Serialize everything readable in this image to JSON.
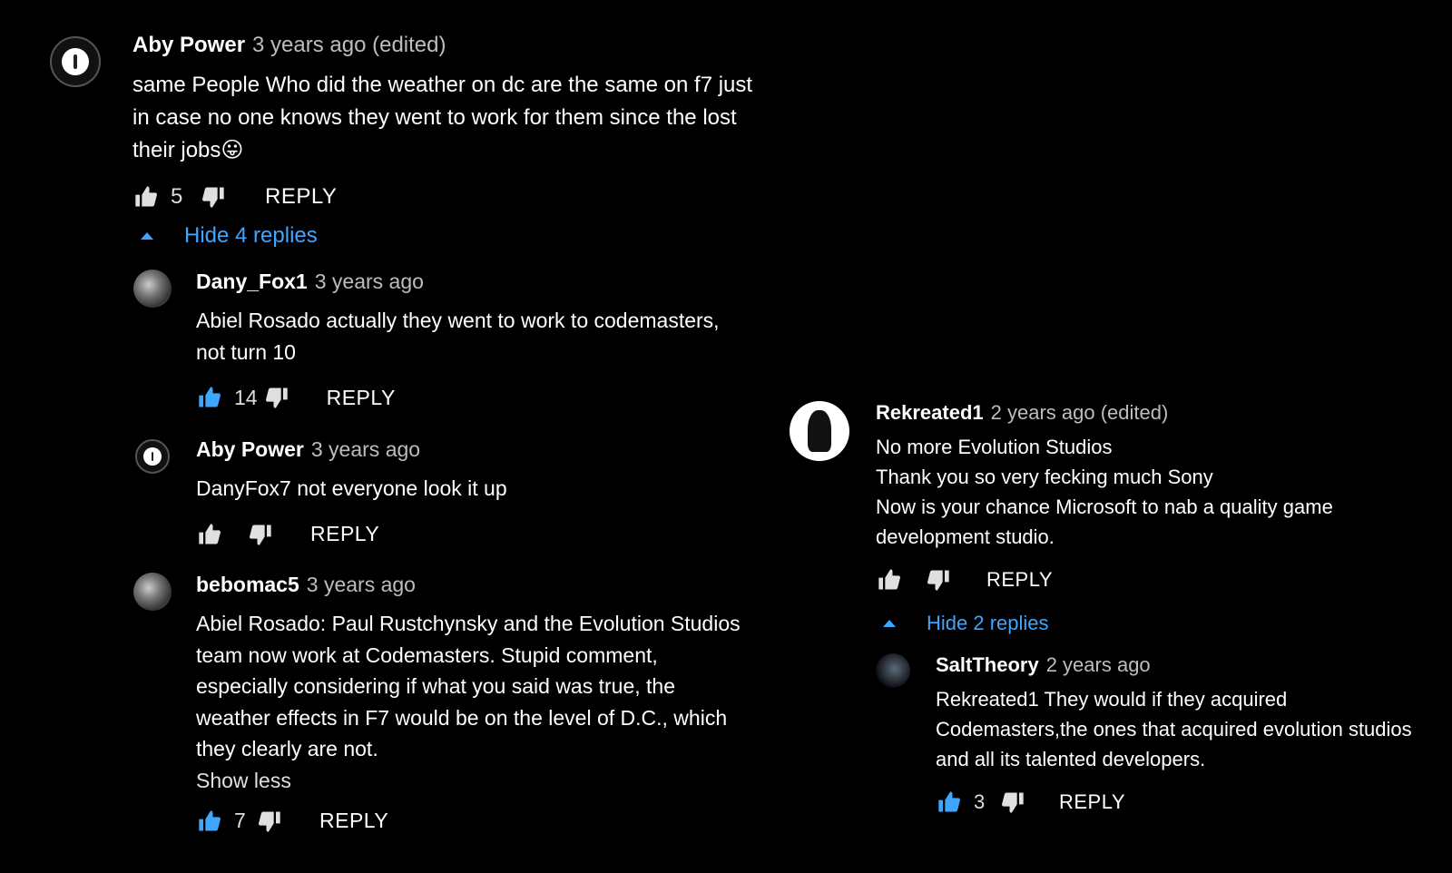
{
  "colors": {
    "background": "#000000",
    "accent": "#3ea6ff",
    "text": "#ffffff",
    "muted": "#bdbdbd"
  },
  "left_thread": {
    "top": {
      "author": "Aby Power",
      "time": "3 years ago (edited)",
      "lines": [
        "same People Who did the weather on dc are the same on f7 just",
        "in case no one knows they went to work for them since the lost",
        "their jobs😛"
      ],
      "likes": "5",
      "reply_label": "REPLY"
    },
    "toggle_label": "Hide 4 replies",
    "replies": [
      {
        "author": "Dany_Fox1",
        "time": "3 years ago",
        "lines": [
          "Abiel Rosado actually they went to work to codemasters,",
          "not turn 10"
        ],
        "likes": "14",
        "liked": true,
        "reply_label": "REPLY"
      },
      {
        "author": "Aby Power",
        "time": "3 years ago",
        "lines": [
          "DanyFox7 not everyone look it up"
        ],
        "likes": "",
        "reply_label": "REPLY"
      },
      {
        "author": "bebomac5",
        "time": "3 years ago",
        "lines": [
          "Abiel Rosado: Paul Rustchynsky and the Evolution Studios",
          "team now work at Codemasters. Stupid comment,",
          "especially considering if what you said was true, the",
          "weather effects in F7 would be on the level of D.C., which",
          "they clearly are not."
        ],
        "show_less": "Show less",
        "likes": "7",
        "liked": true,
        "reply_label": "REPLY"
      }
    ]
  },
  "right_thread": {
    "top": {
      "author": "Rekreated1",
      "time": "2 years ago (edited)",
      "lines": [
        "No more Evolution Studios",
        "Thank you so very fecking much Sony",
        "Now is your chance Microsoft to nab a quality game",
        "development studio."
      ],
      "likes": "",
      "reply_label": "REPLY"
    },
    "toggle_label": "Hide 2 replies",
    "replies": [
      {
        "author": "SaltTheory",
        "time": "2 years ago",
        "lines": [
          "Rekreated1 They would if they acquired",
          "Codemasters,the ones that acquired evolution studios",
          "and all its talented developers."
        ],
        "likes": "3",
        "liked": true,
        "reply_label": "REPLY"
      }
    ]
  },
  "icons": {
    "like": "thumbs-up-icon",
    "dislike": "thumbs-down-icon",
    "toggle": "caret-up-icon"
  }
}
